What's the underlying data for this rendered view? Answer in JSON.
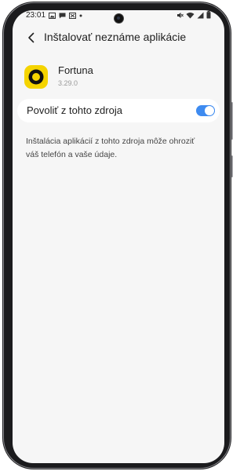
{
  "status_bar": {
    "time": "23:01",
    "left_icons": [
      "gallery-icon",
      "message-icon",
      "no-signal-icon",
      "dot-icon"
    ],
    "right_icons": [
      "mute-icon",
      "wifi-icon",
      "signal-icon",
      "battery-icon"
    ]
  },
  "header": {
    "title": "Inštalovať neznáme aplikácie"
  },
  "app": {
    "name": "Fortuna",
    "version": "3.29.0",
    "icon_color": "#f5d400"
  },
  "setting": {
    "label": "Povoliť z tohto zdroja",
    "enabled": true,
    "accent_color": "#3e8bf0"
  },
  "description": {
    "line1": "Inštalácia aplikácií z tohto zdroja môže ohroziť",
    "line2": "váš telefón a vaše údaje."
  }
}
